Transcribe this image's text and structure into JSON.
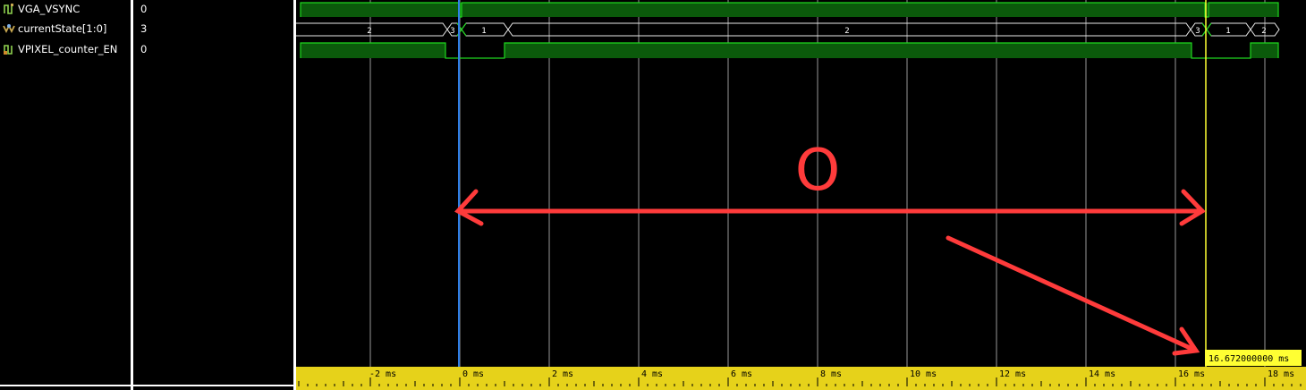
{
  "signals": [
    {
      "name": "VGA_VSYNC",
      "value": "0",
      "icon": "bit-signal-icon"
    },
    {
      "name": "currentState[1:0]",
      "value": "3",
      "icon": "bus-signal-icon"
    },
    {
      "name": "VPIXEL_counter_EN",
      "value": "0",
      "icon": "bit-signal-icon"
    }
  ],
  "state_labels": [
    "2",
    "3",
    "1",
    "2",
    "3",
    "1",
    "2"
  ],
  "timeline": {
    "tick_labels": [
      "-2 ms",
      "0 ms",
      "2 ms",
      "4 ms",
      "6 ms",
      "8 ms",
      "10 ms",
      "12 ms",
      "14 ms",
      "16 ms",
      "18 ms"
    ],
    "cursor_value": "16.672000000 ms"
  },
  "annotations": {
    "circle_text": "O"
  },
  "colors": {
    "wave_fill": "#0b5a0b",
    "wave_line": "#1fd61f",
    "cursor_blue": "#2f7fe8",
    "cursor_yellow": "#ffff33",
    "ruler": "#e6d21a",
    "annotation": "#ff3b3b"
  }
}
